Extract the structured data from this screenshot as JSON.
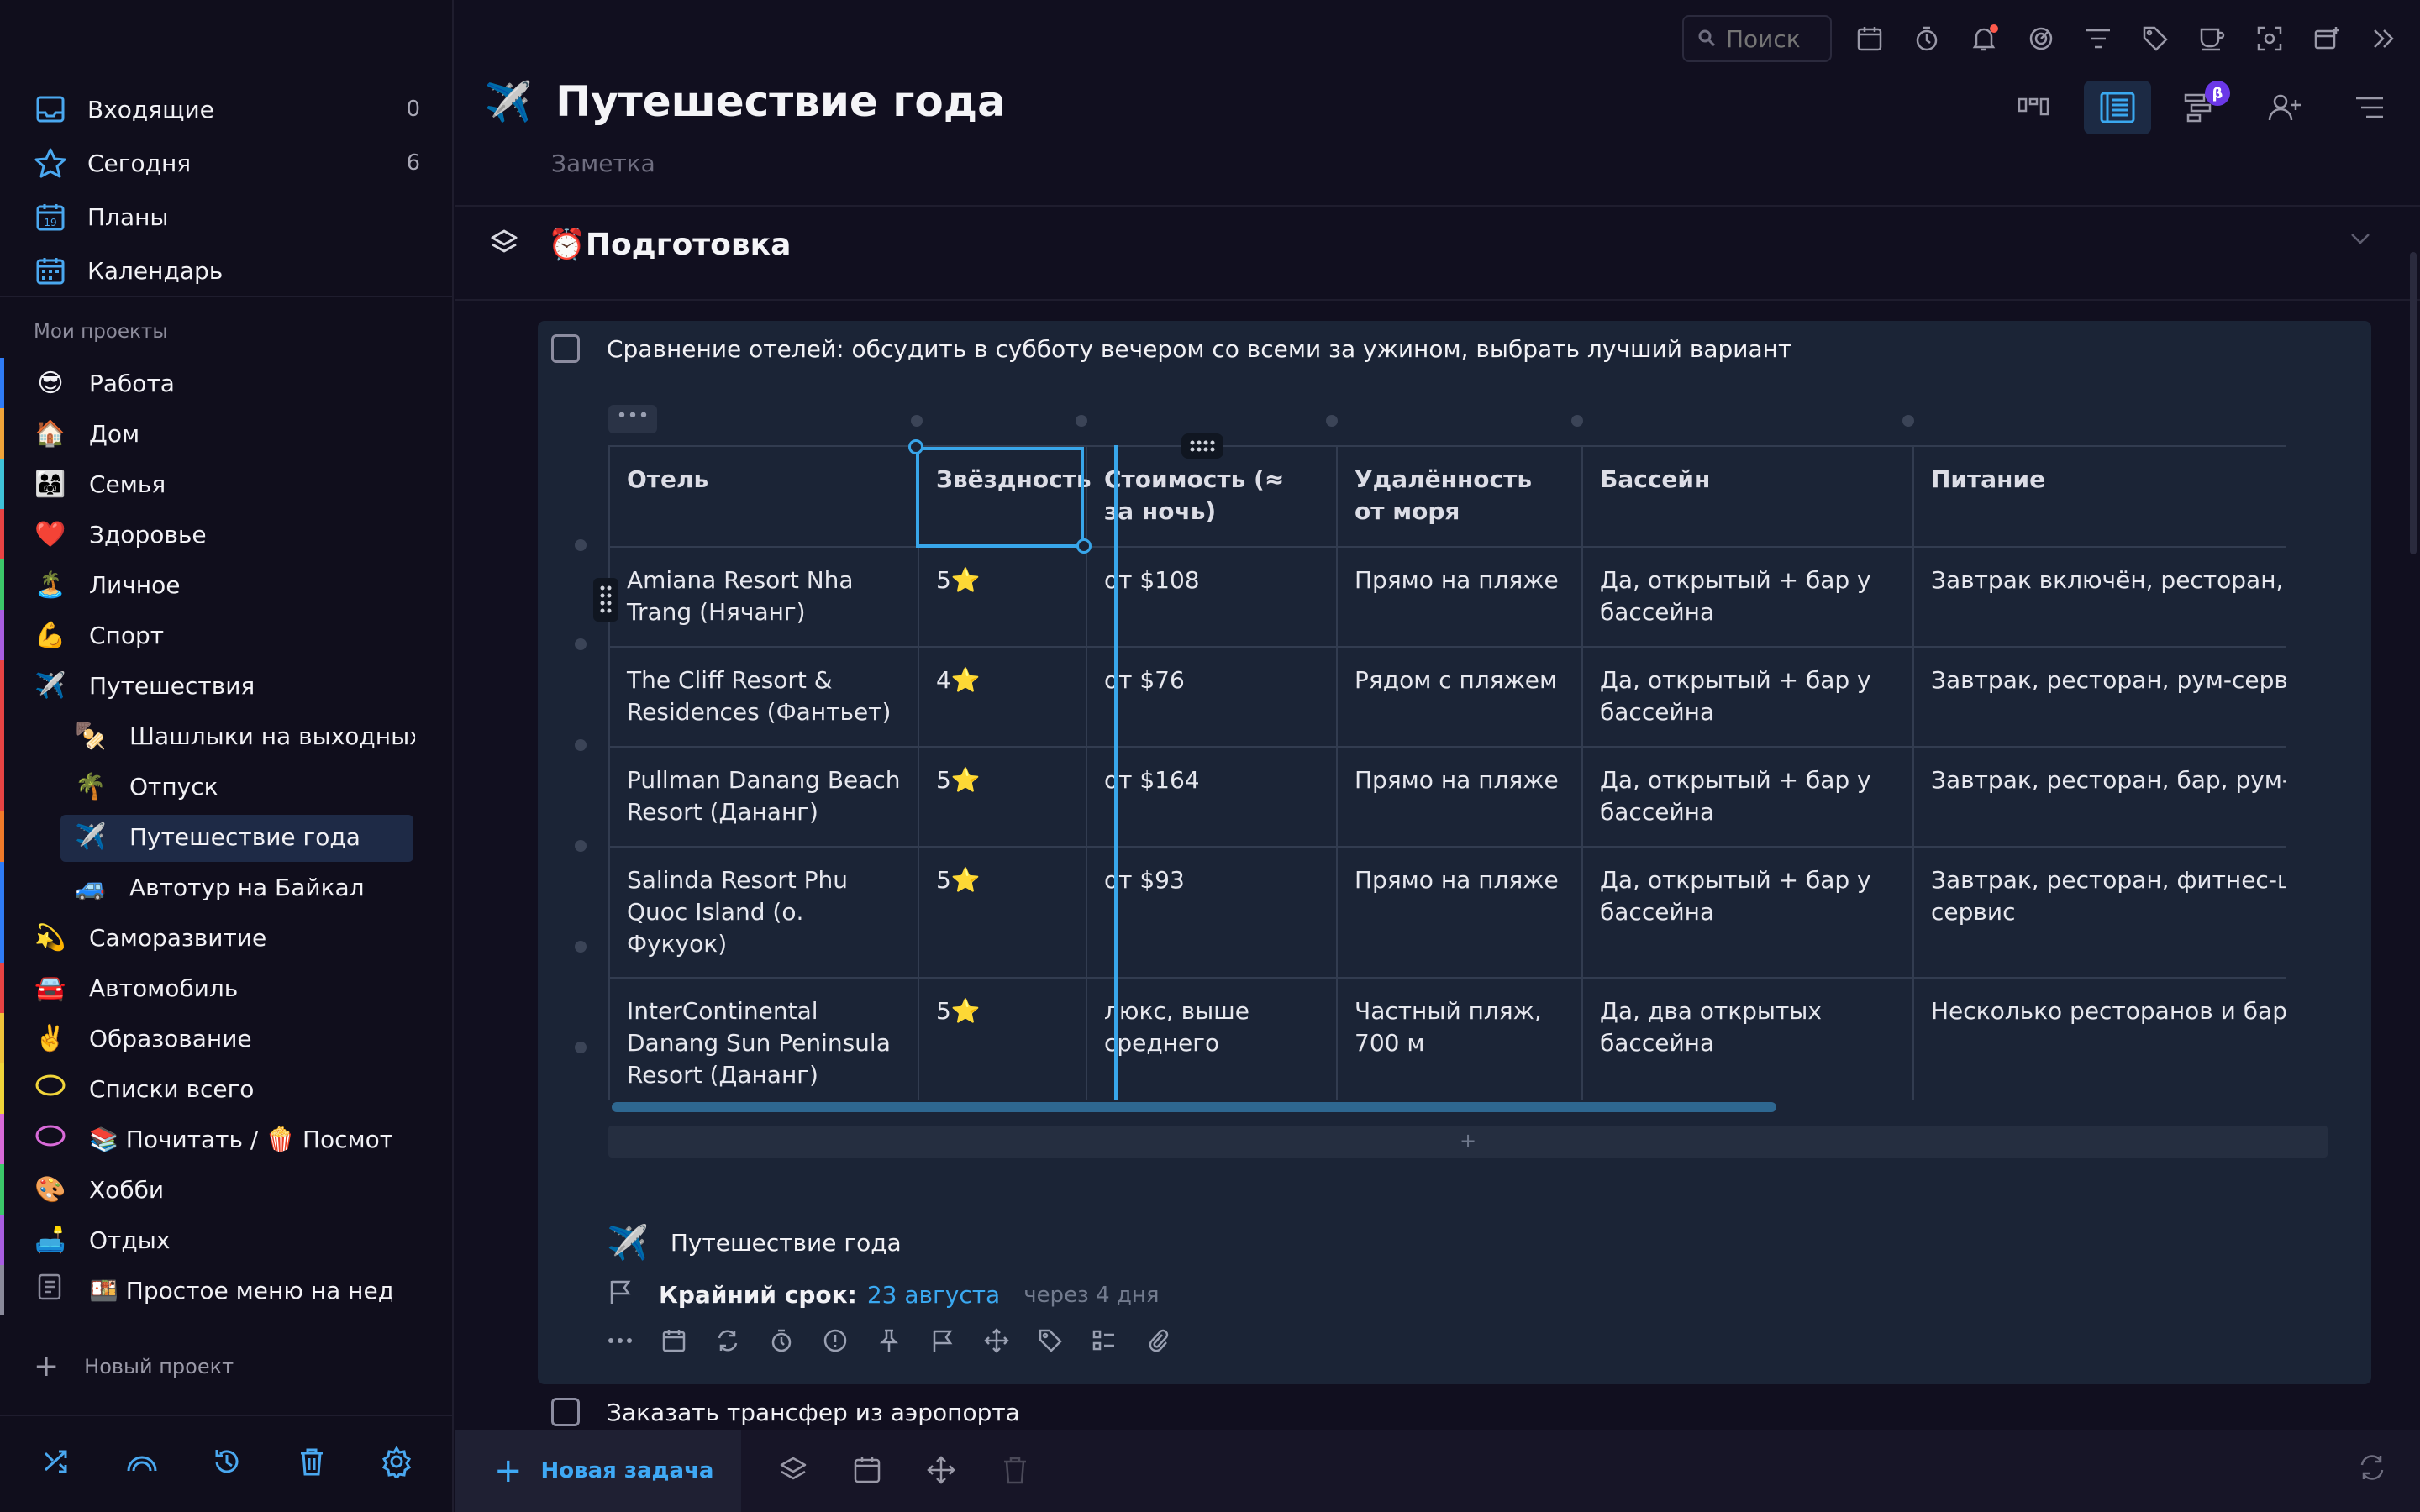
{
  "sidebar": {
    "nav": [
      {
        "label": "Входящие",
        "count": "0",
        "icon": "inbox-icon"
      },
      {
        "label": "Сегодня",
        "count": "6",
        "icon": "star-icon"
      },
      {
        "label": "Планы",
        "count": "",
        "icon": "calendar-19-icon"
      },
      {
        "label": "Календарь",
        "count": "",
        "icon": "calendar-grid-icon"
      }
    ],
    "section_label": "Мои проекты",
    "projects": [
      {
        "emoji": "😎",
        "label": "Работа",
        "color": "#2f7bf5",
        "sub": false
      },
      {
        "emoji": "🏠",
        "label": "Дом",
        "color": "#f0a43a",
        "sub": false
      },
      {
        "emoji": "👨‍👩‍👧",
        "label": "Семья",
        "color": "#3fc2d8",
        "sub": false
      },
      {
        "emoji": "❤️",
        "label": "Здоровье",
        "color": "#e84343",
        "sub": false
      },
      {
        "emoji": "🏝️",
        "label": "Личное",
        "color": "#3cc86a",
        "sub": false
      },
      {
        "emoji": "💪",
        "label": "Спорт",
        "color": "#a85de0",
        "sub": false
      },
      {
        "emoji": "✈️",
        "label": "Путешествия",
        "color": "#e84343",
        "sub": false
      },
      {
        "emoji": "🍢",
        "label": "Шашлыки на выходных",
        "color": "#e84343",
        "sub": true
      },
      {
        "emoji": "🌴",
        "label": "Отпуск",
        "color": "#e84343",
        "sub": true
      },
      {
        "emoji": "✈️",
        "label": "Путешествие года",
        "color": "#f07a2a",
        "sub": true,
        "active": true
      },
      {
        "emoji": "🚙",
        "label": "Автотур на Байкал",
        "color": "#2f7bf5",
        "sub": true
      },
      {
        "emoji": "💫",
        "label": "Саморазвитие",
        "color": "#2f7bf5",
        "sub": false
      },
      {
        "emoji": "🚘",
        "label": "Автомобиль",
        "color": "#e84343",
        "sub": false
      },
      {
        "emoji": "✌️",
        "label": "Образование",
        "color": "#f0c23a",
        "sub": false
      },
      {
        "emoji": "",
        "label": "Списки всего",
        "color": "#f0d43a",
        "sub": false,
        "ring": "#f0d43a"
      },
      {
        "emoji": "",
        "label": "📚 Почитать / 🍿 Посмотреть",
        "color": "#d86ad8",
        "sub": false,
        "ring": "#d86ad8"
      },
      {
        "emoji": "🎨",
        "label": "Хобби",
        "color": "#3cc86a",
        "sub": false
      },
      {
        "emoji": "🛋️",
        "label": "Отдых",
        "color": "#a85de0",
        "sub": false
      },
      {
        "emoji": "",
        "label": "🍱 Простое меню на неделю",
        "color": "#8a8a9a",
        "sub": false,
        "doc": true
      }
    ],
    "new_project": "Новый проект"
  },
  "topbar": {
    "search_placeholder": "Поиск"
  },
  "page": {
    "emoji": "✈️",
    "title": "Путешествие года",
    "subtitle": "Заметка"
  },
  "section": {
    "title": "⏰Подготовка"
  },
  "task": {
    "title": "Сравнение отелей: обсудить в субботу вечером со всеми за ужином, выбрать лучший вариант",
    "table": {
      "headers": [
        "Отель",
        "Звёздность",
        "Стоимость (≈ за ночь)",
        "Удалённость от моря",
        "Бассейн",
        "Питание"
      ],
      "rows": [
        [
          "Amiana Resort Nha Trang (Нячанг)",
          "5⭐",
          "от $108",
          "Прямо на пляже",
          "Да, открытый + бар у бассейна",
          "Завтрак включён, ресторан, рум-сервис"
        ],
        [
          "The Cliff Resort & Residences (Фантьет)",
          "4⭐",
          "от $76",
          "Рядом с пляжем",
          "Да, открытый + бар у бассейна",
          "Завтрак, ресторан, рум-сервис"
        ],
        [
          "Pullman Danang Beach Resort (Дананг)",
          "5⭐",
          "от $164",
          "Прямо на пляже",
          "Да, открытый + бар у бассейна",
          "Завтрак, ресторан, бар, рум-сервис"
        ],
        [
          "Salinda Resort Phu Quoc Island (о. Фукуок)",
          "5⭐",
          "от $93",
          "Прямо на пляже",
          "Да, открытый + бар у бассейна",
          "Завтрак, ресторан, фитнес-центр, рум-сервис"
        ],
        [
          "InterContinental Danang Sun Peninsula Resort (Дананг)",
          "5⭐",
          "люкс, выше среднего",
          "Частный пляж, 700 м",
          "Да, два открытых бассейна",
          "Несколько ресторанов и баров"
        ]
      ]
    },
    "add_row": "+",
    "project_emoji": "✈️",
    "project": "Путешествие года",
    "deadline_label": "Крайний срок:",
    "deadline_date": "23 августа",
    "deadline_rel": "через 4 дня"
  },
  "task2": {
    "title": "Заказать трансфер из аэропорта"
  },
  "bottom": {
    "new_task": "Новая задача"
  },
  "colors": {
    "accent": "#3aa8f0",
    "selection": "#38a6ea",
    "beta": "#6b38e8"
  },
  "beta_badge": "β"
}
